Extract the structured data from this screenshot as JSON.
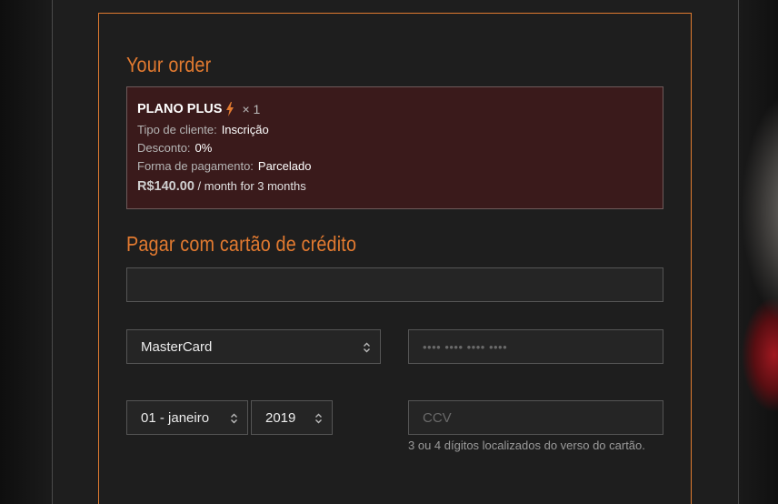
{
  "order": {
    "heading": "Your order",
    "product_name": "PLANO PLUS",
    "quantity": "× 1",
    "client_type_label": "Tipo de cliente:",
    "client_type_value": "Inscrição",
    "discount_label": "Desconto:",
    "discount_value": "0%",
    "payment_method_label": "Forma de pagamento:",
    "payment_method_value": "Parcelado",
    "price": "R$140.00",
    "price_suffix": "/ month for 3 months"
  },
  "payment": {
    "heading": "Pagar com cartão de crédito",
    "name_value": "",
    "card_type": "MasterCard",
    "card_number_placeholder": "•••• •••• •••• ••••",
    "expiry_month": "01 - janeiro",
    "expiry_year": "2019",
    "ccv_placeholder": "CCV",
    "ccv_hint": "3 ou 4 dígitos localizados do verso do cartão."
  },
  "colors": {
    "accent": "#e27a30",
    "order_bg": "#3a1a1b",
    "panel_bg": "#1e1e1e"
  },
  "icons": {
    "product": "lightning-bolt-icon",
    "select": "up-down-chevron-icon"
  }
}
